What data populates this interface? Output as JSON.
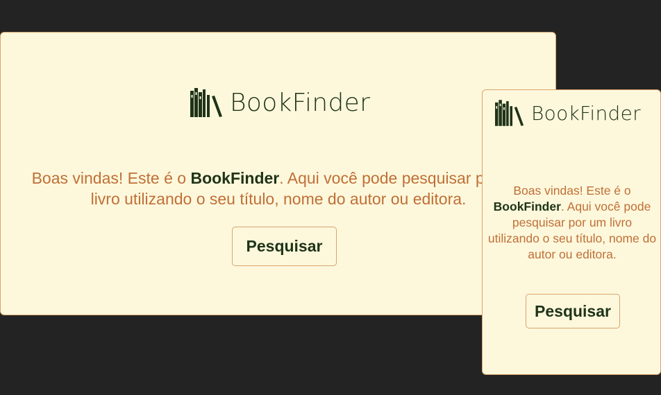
{
  "brand": {
    "name": "BookFinder",
    "text_color": "#1f3318",
    "accent_color": "#c06f37",
    "card_background": "#fdf8dc",
    "page_background": "#232323",
    "logo_icon": "books-shelf-icon"
  },
  "desktop": {
    "logo_text": "BookFinder",
    "welcome_before": "Boas vindas! Este é o ",
    "welcome_bold": "BookFinder",
    "welcome_after": ". Aqui você pode pesquisar por um livro utilizando o seu título, nome do autor ou editora.",
    "button_label": "Pesquisar"
  },
  "mobile": {
    "logo_text": "BookFinder",
    "welcome_before": "Boas vindas! Este é o ",
    "welcome_bold": "BookFinder",
    "welcome_after": ". Aqui você pode pesquisar por um livro utilizando o seu título, nome do autor ou editora.",
    "button_label": "Pesquisar"
  }
}
